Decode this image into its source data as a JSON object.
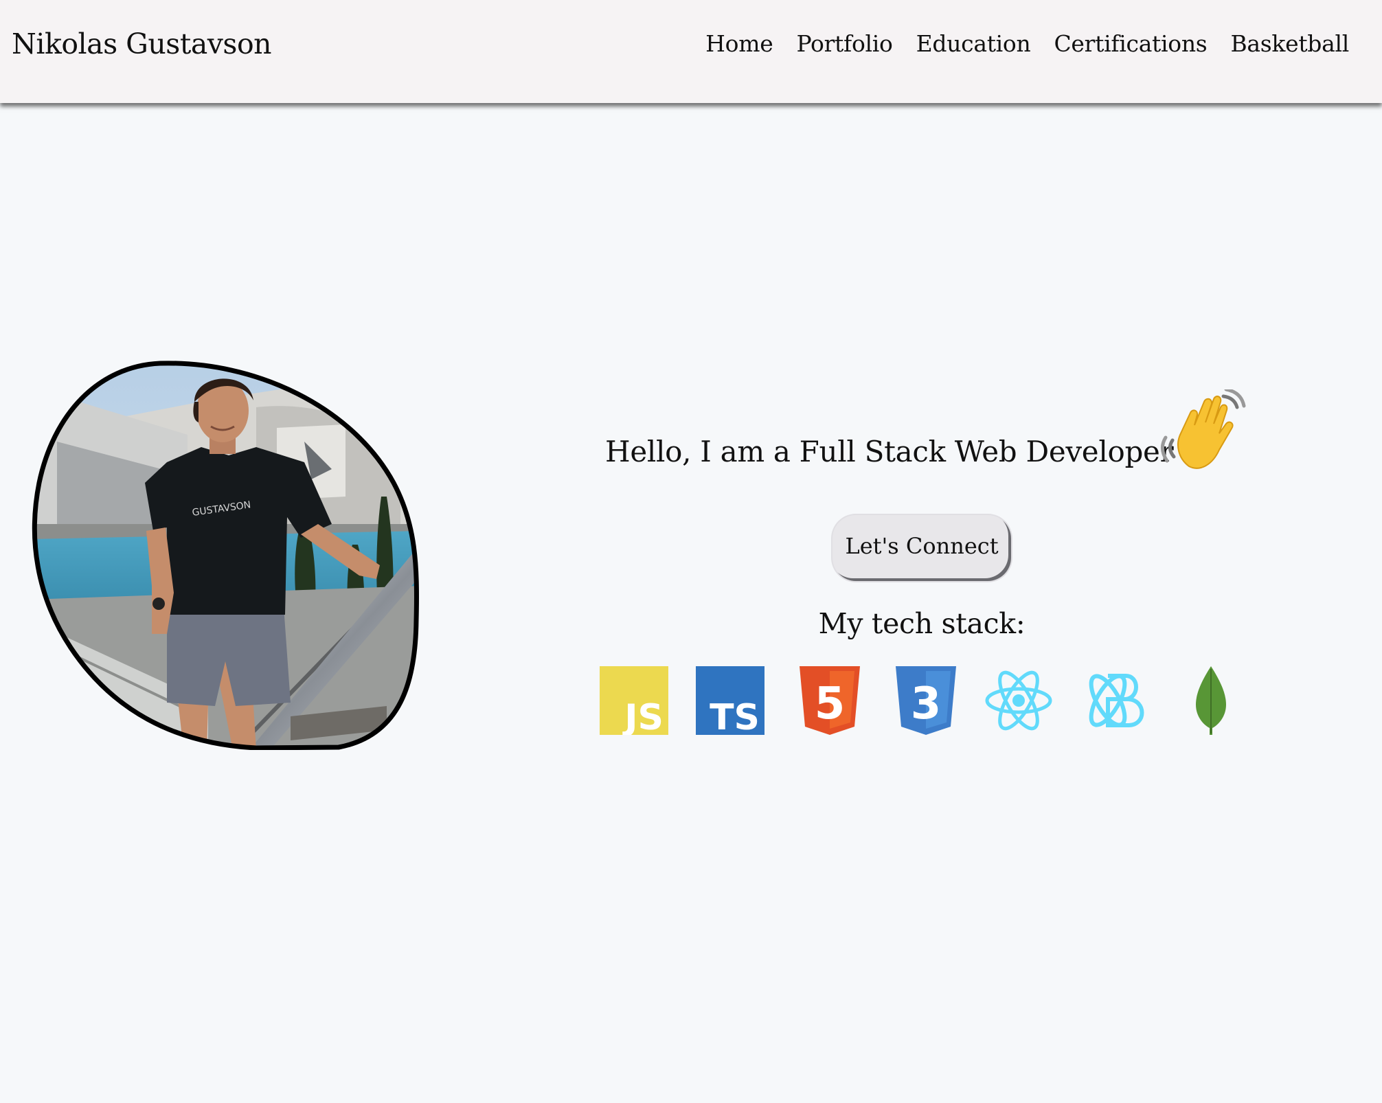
{
  "navbar": {
    "brand": "Nikolas Gustavson",
    "links": [
      "Home",
      "Portfolio",
      "Education",
      "Certifications",
      "Basketball"
    ]
  },
  "profile": {
    "photo_icon": "profile-photo",
    "shirt_text": "GUSTAVSON"
  },
  "hero": {
    "greeting": "Hello, I am a Full Stack Web Developer",
    "wave_icon": "waving-hand-icon",
    "connect_label": "Let's Connect",
    "stack_title": "My tech stack:"
  },
  "tech_stack": [
    {
      "name": "javascript",
      "text": "JS",
      "color": "#ecd94f"
    },
    {
      "name": "typescript",
      "text": "TS",
      "color": "#2f74c0"
    },
    {
      "name": "html5",
      "text": "5",
      "color": "#e34f26"
    },
    {
      "name": "css3",
      "text": "3",
      "color": "#3d7cc9"
    },
    {
      "name": "react",
      "color": "#61dafb"
    },
    {
      "name": "redux-toolkit",
      "color": "#61dafb"
    },
    {
      "name": "mongodb",
      "color": "#589636"
    }
  ],
  "colors": {
    "page_bg": "#f6f8fa",
    "navbar_bg": "#f6f3f4",
    "button_bg": "#e8e7ea"
  }
}
